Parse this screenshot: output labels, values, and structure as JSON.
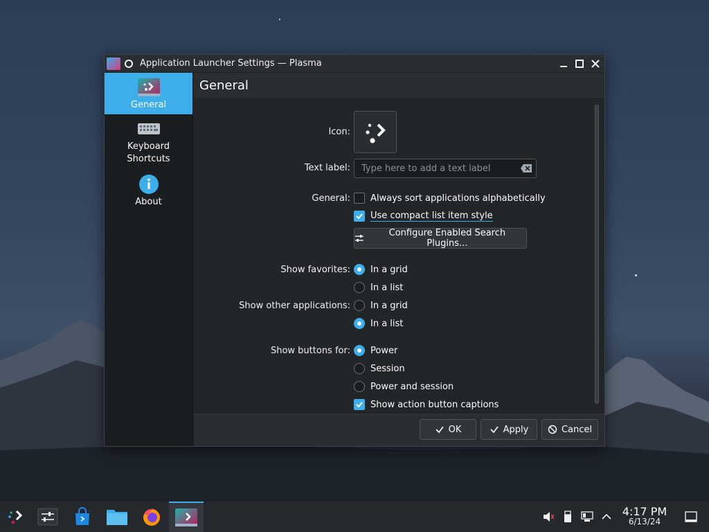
{
  "window": {
    "title": "Application Launcher Settings — Plasma"
  },
  "sidebar": {
    "items": [
      {
        "label": "General",
        "icon": "kickoff-launcher-icon",
        "active": true
      },
      {
        "label": "Keyboard\nShortcuts",
        "icon": "keyboard-icon",
        "active": false
      },
      {
        "label": "About",
        "icon": "info-icon",
        "active": false
      }
    ]
  },
  "page": {
    "title": "General",
    "icon_label": "Icon:",
    "text_label": {
      "label": "Text label:",
      "placeholder": "Type here to add a text label",
      "value": ""
    },
    "general": {
      "label": "General:",
      "always_sort": {
        "label": "Always sort applications alphabetically",
        "checked": false
      },
      "compact_list": {
        "label": "Use compact list item style",
        "checked": true
      },
      "configure_plugins": "Configure Enabled Search Plugins..."
    },
    "show_favorites": {
      "label": "Show favorites:",
      "options": [
        "In a grid",
        "In a list"
      ],
      "selected": "In a grid"
    },
    "show_other_apps": {
      "label": "Show other applications:",
      "options": [
        "In a grid",
        "In a list"
      ],
      "selected": "In a list"
    },
    "show_buttons_for": {
      "label": "Show buttons for:",
      "options": [
        "Power",
        "Session",
        "Power and session"
      ],
      "selected": "Power"
    },
    "show_captions": {
      "label": "Show action button captions",
      "checked": true
    }
  },
  "footer": {
    "ok": "OK",
    "apply": "Apply",
    "cancel": "Cancel"
  },
  "taskbar": {
    "time": "4:17 PM",
    "date": "6/13/24"
  },
  "colors": {
    "accent": "#3daee9",
    "window_bg": "#232629",
    "sidebar_bg": "#1b1e20"
  }
}
